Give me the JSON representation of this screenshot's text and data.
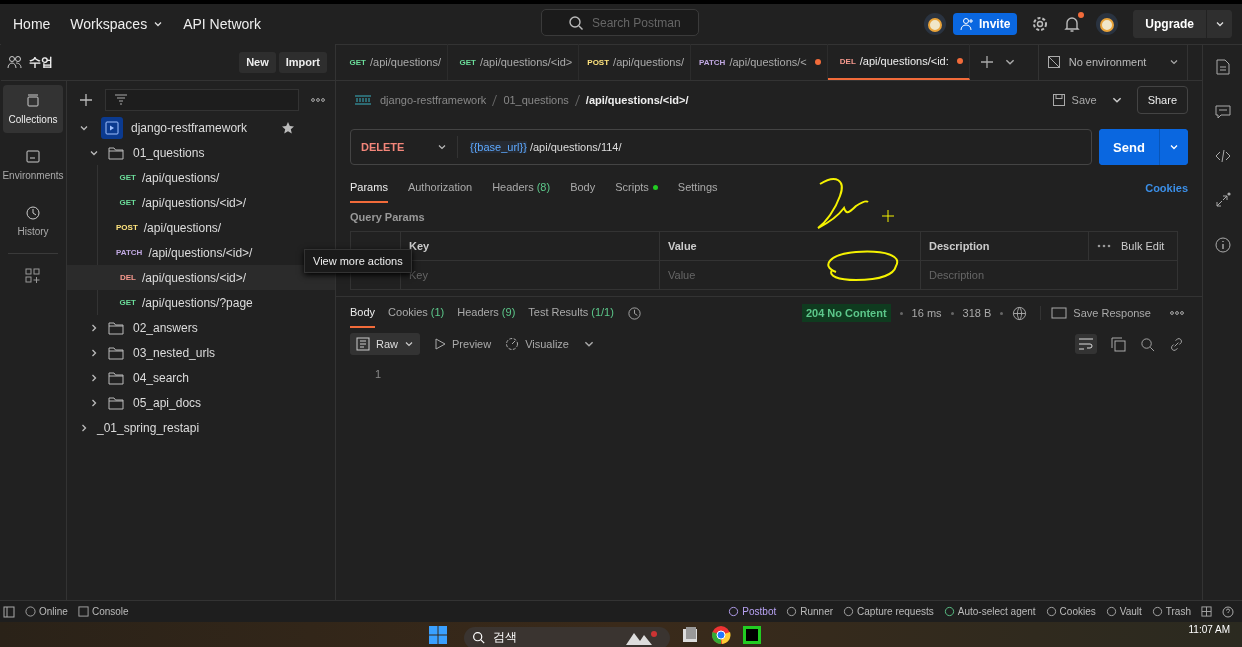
{
  "header": {
    "nav": [
      {
        "label": "Home",
        "menu": false
      },
      {
        "label": "Workspaces",
        "menu": true
      },
      {
        "label": "API Network",
        "menu": false
      }
    ],
    "search": {
      "placeholder": "Search Postman"
    },
    "invite": "Invite",
    "upgrade": "Upgrade",
    "notification": true
  },
  "workspace": {
    "name": "수업",
    "buttons": [
      "New",
      "Import"
    ]
  },
  "rail": [
    {
      "label": "Collections",
      "selected": true
    },
    {
      "label": "Environments",
      "selected": false
    },
    {
      "label": "History",
      "selected": false
    }
  ],
  "tree": [
    {
      "kind": "collection",
      "label": "django-restframework",
      "expanded": true,
      "starred": true,
      "children": [
        {
          "kind": "folder",
          "label": "01_questions",
          "expanded": true,
          "children": [
            {
              "kind": "request",
              "method": "GET",
              "color": "#6bdd9a",
              "label": "/api/questions/",
              "selected": false
            },
            {
              "kind": "request",
              "method": "GET",
              "color": "#6bdd9a",
              "label": "/api/questions/<id>/",
              "selected": false
            },
            {
              "kind": "request",
              "method": "POST",
              "color": "#ffe47e",
              "label": "/api/questions/",
              "selected": false
            },
            {
              "kind": "request",
              "method": "PATCH",
              "color": "#c0a8e1",
              "label": "/api/questions/<id>/",
              "selected": false
            },
            {
              "kind": "request",
              "method": "DEL",
              "color": "#f79a8e",
              "label": "/api/questions/<id>/",
              "selected": true
            },
            {
              "kind": "request",
              "method": "GET",
              "color": "#6bdd9a",
              "label": "/api/questions/?page",
              "selected": false
            }
          ]
        },
        {
          "kind": "folder",
          "label": "02_answers",
          "expanded": false
        },
        {
          "kind": "folder",
          "label": "03_nested_urls",
          "expanded": false
        },
        {
          "kind": "folder",
          "label": "04_search",
          "expanded": false
        },
        {
          "kind": "folder",
          "label": "05_api_docs",
          "expanded": false
        }
      ]
    },
    {
      "kind": "collection",
      "label": "_01_spring_restapi",
      "expanded": false,
      "starred": false
    }
  ],
  "tooltip": "View more actions",
  "tabs": [
    {
      "method": "GET",
      "color": "#6bdd9a",
      "label": "/api/questions/",
      "selected": false,
      "unsaved": false
    },
    {
      "method": "GET",
      "color": "#6bdd9a",
      "label": "/api/questions/<id>",
      "selected": false,
      "unsaved": false
    },
    {
      "method": "POST",
      "color": "#ffe47e",
      "label": "/api/questions/",
      "selected": false,
      "unsaved": false
    },
    {
      "method": "PATCH",
      "color": "#c0a8e1",
      "label": "/api/questions/<",
      "selected": false,
      "unsaved": true
    },
    {
      "method": "DEL",
      "color": "#f79a8e",
      "label": "/api/questions/<id:",
      "selected": true,
      "unsaved": true
    }
  ],
  "environment": "No environment",
  "breadcrumb": [
    "django-restframework",
    "01_questions",
    "/api/questions/<id>/"
  ],
  "save": "Save",
  "share": "Share",
  "request": {
    "method": "DELETE",
    "variable": "{{base_url}}",
    "path": "/api/questions/114/",
    "send": "Send"
  },
  "request_tabs": [
    {
      "label": "Params",
      "selected": true,
      "dot": false
    },
    {
      "label": "Authorization",
      "selected": false,
      "dot": false
    },
    {
      "label": "Headers",
      "count": "(8)",
      "selected": false,
      "dot": false
    },
    {
      "label": "Body",
      "selected": false,
      "dot": false
    },
    {
      "label": "Scripts",
      "selected": false,
      "dot": true
    },
    {
      "label": "Settings",
      "selected": false,
      "dot": false
    }
  ],
  "cookies_link": "Cookies",
  "query_params": {
    "title": "Query Params",
    "columns": [
      "Key",
      "Value",
      "Description"
    ],
    "bulk_edit": "Bulk Edit",
    "placeholders": [
      "Key",
      "Value",
      "Description"
    ]
  },
  "response_tabs": [
    {
      "label": "Body",
      "selected": true
    },
    {
      "label": "Cookies",
      "count": "(1)",
      "selected": false
    },
    {
      "label": "Headers",
      "count": "(9)",
      "selected": false
    },
    {
      "label": "Test Results",
      "count": "(1/1)",
      "selected": false
    }
  ],
  "response": {
    "status": "204 No Content",
    "time": "16 ms",
    "size": "318 B",
    "save": "Save Response"
  },
  "body_toolbar": {
    "format": "Raw",
    "preview": "Preview",
    "visualize": "Visualize"
  },
  "editor": {
    "lines": [
      "1"
    ]
  },
  "status_bar": {
    "left": [
      "Online",
      "Console"
    ],
    "right": [
      "Postbot",
      "Runner",
      "Capture requests",
      "Auto-select agent",
      "Cookies",
      "Vault",
      "Trash"
    ]
  },
  "taskbar": {
    "search": "검색",
    "time": "11:07 AM"
  }
}
